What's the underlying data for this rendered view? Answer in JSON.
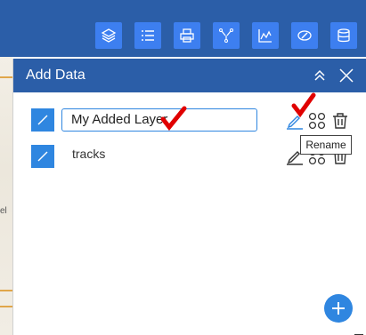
{
  "toolbar": {
    "tools": [
      {
        "icon": "layers-icon"
      },
      {
        "icon": "list-icon"
      },
      {
        "icon": "print-icon"
      },
      {
        "icon": "network-icon"
      },
      {
        "icon": "chart-icon"
      },
      {
        "icon": "edit-shape-icon"
      },
      {
        "icon": "database-icon"
      }
    ]
  },
  "map": {
    "edge_label": "el"
  },
  "panel": {
    "title": "Add Data",
    "layers": [
      {
        "name": "My Added Layer",
        "editing": true
      },
      {
        "name": "tracks",
        "editing": false
      }
    ],
    "tooltip": "Rename"
  },
  "colors": {
    "header": "#2b5ea8",
    "tool_button": "#3d7ff0",
    "accent": "#2f86e0",
    "annotation_check": "#e00000"
  }
}
